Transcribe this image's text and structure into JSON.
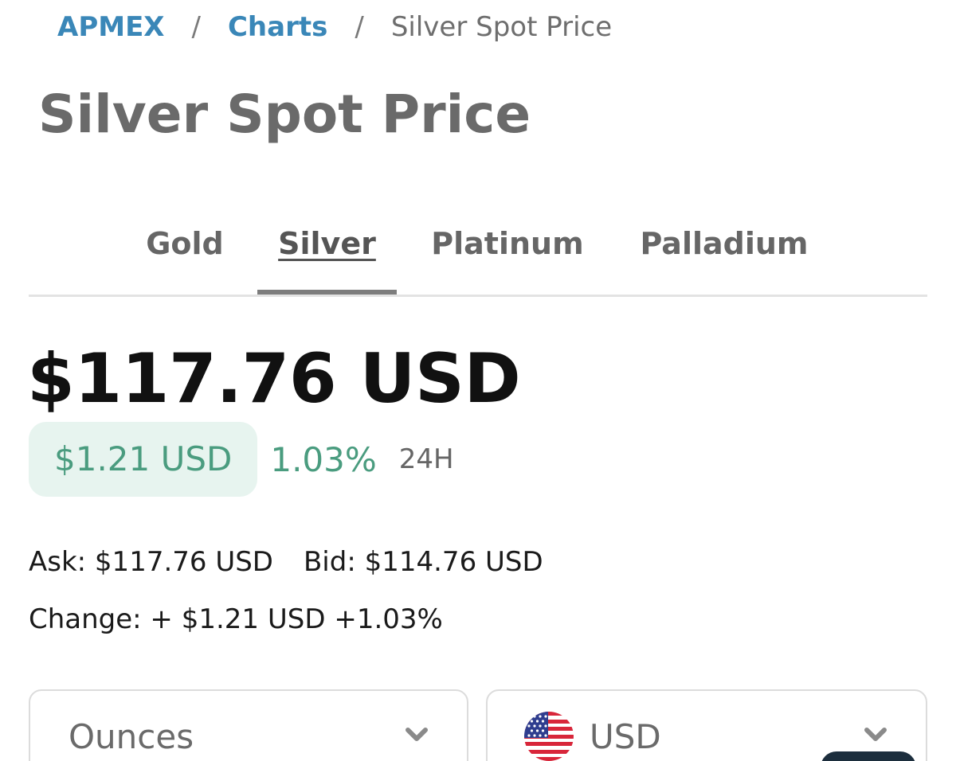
{
  "breadcrumb": {
    "items": [
      {
        "label": "APMEX"
      },
      {
        "label": "Charts"
      }
    ],
    "current": "Silver Spot Price",
    "separator": "/"
  },
  "page": {
    "title": "Silver Spot Price"
  },
  "tabs": [
    {
      "label": "Gold",
      "active": false
    },
    {
      "label": "Silver",
      "active": true
    },
    {
      "label": "Platinum",
      "active": false
    },
    {
      "label": "Palladium",
      "active": false
    }
  ],
  "price": {
    "main": "$117.76 USD",
    "change_amount": "$1.21 USD",
    "change_percent": "1.03%",
    "period": "24H",
    "ask": "Ask: $117.76 USD",
    "bid": "Bid: $114.76 USD",
    "change_line": "Change: + $1.21 USD +1.03%"
  },
  "selectors": {
    "unit": {
      "value": "Ounces",
      "icon": "chevron-down-icon"
    },
    "currency": {
      "value": "USD",
      "icon": "us-flag-icon"
    }
  },
  "colors": {
    "link": "#3a87b8",
    "positive": "#4a9c7f",
    "positive_bg": "#e7f4ef"
  }
}
